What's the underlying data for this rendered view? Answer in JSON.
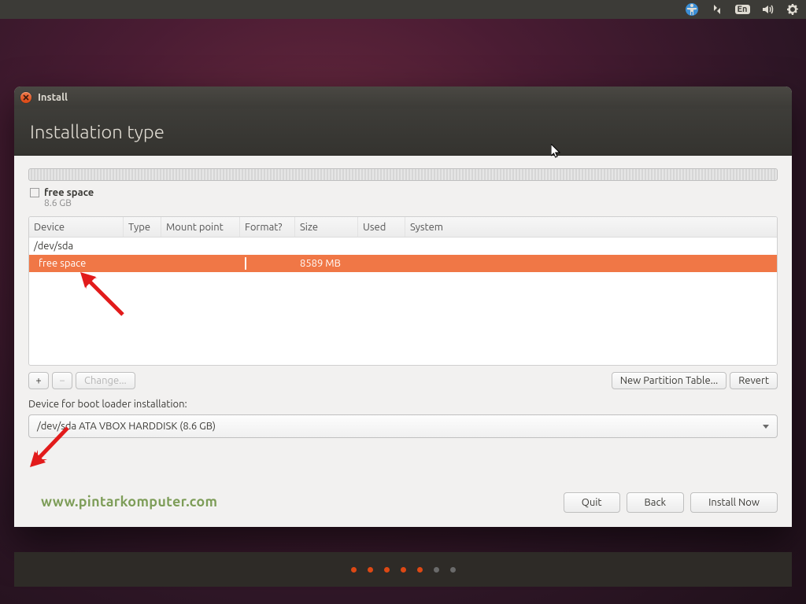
{
  "menubar": {
    "language_code": "En"
  },
  "window": {
    "title": "Install",
    "heading": "Installation type"
  },
  "legend": {
    "name": "free space",
    "size": "8.6 GB"
  },
  "columns": {
    "device": "Device",
    "type": "Type",
    "mount": "Mount point",
    "format": "Format?",
    "size": "Size",
    "used": "Used",
    "system": "System"
  },
  "rows": {
    "disk": {
      "device": "/dev/sda"
    },
    "free": {
      "device": "free space",
      "size": "8589 MB"
    }
  },
  "toolbar": {
    "plus": "+",
    "minus": "−",
    "change": "Change...",
    "new_table": "New Partition Table...",
    "revert": "Revert"
  },
  "bootloader": {
    "label": "Device for boot loader installation:",
    "value": "/dev/sda  ATA VBOX HARDDISK (8.6 GB)"
  },
  "footer": {
    "quit": "Quit",
    "back": "Back",
    "install": "Install Now"
  },
  "watermark": "www.pintarkomputer.com",
  "pager": {
    "total": 7,
    "active": 5
  }
}
